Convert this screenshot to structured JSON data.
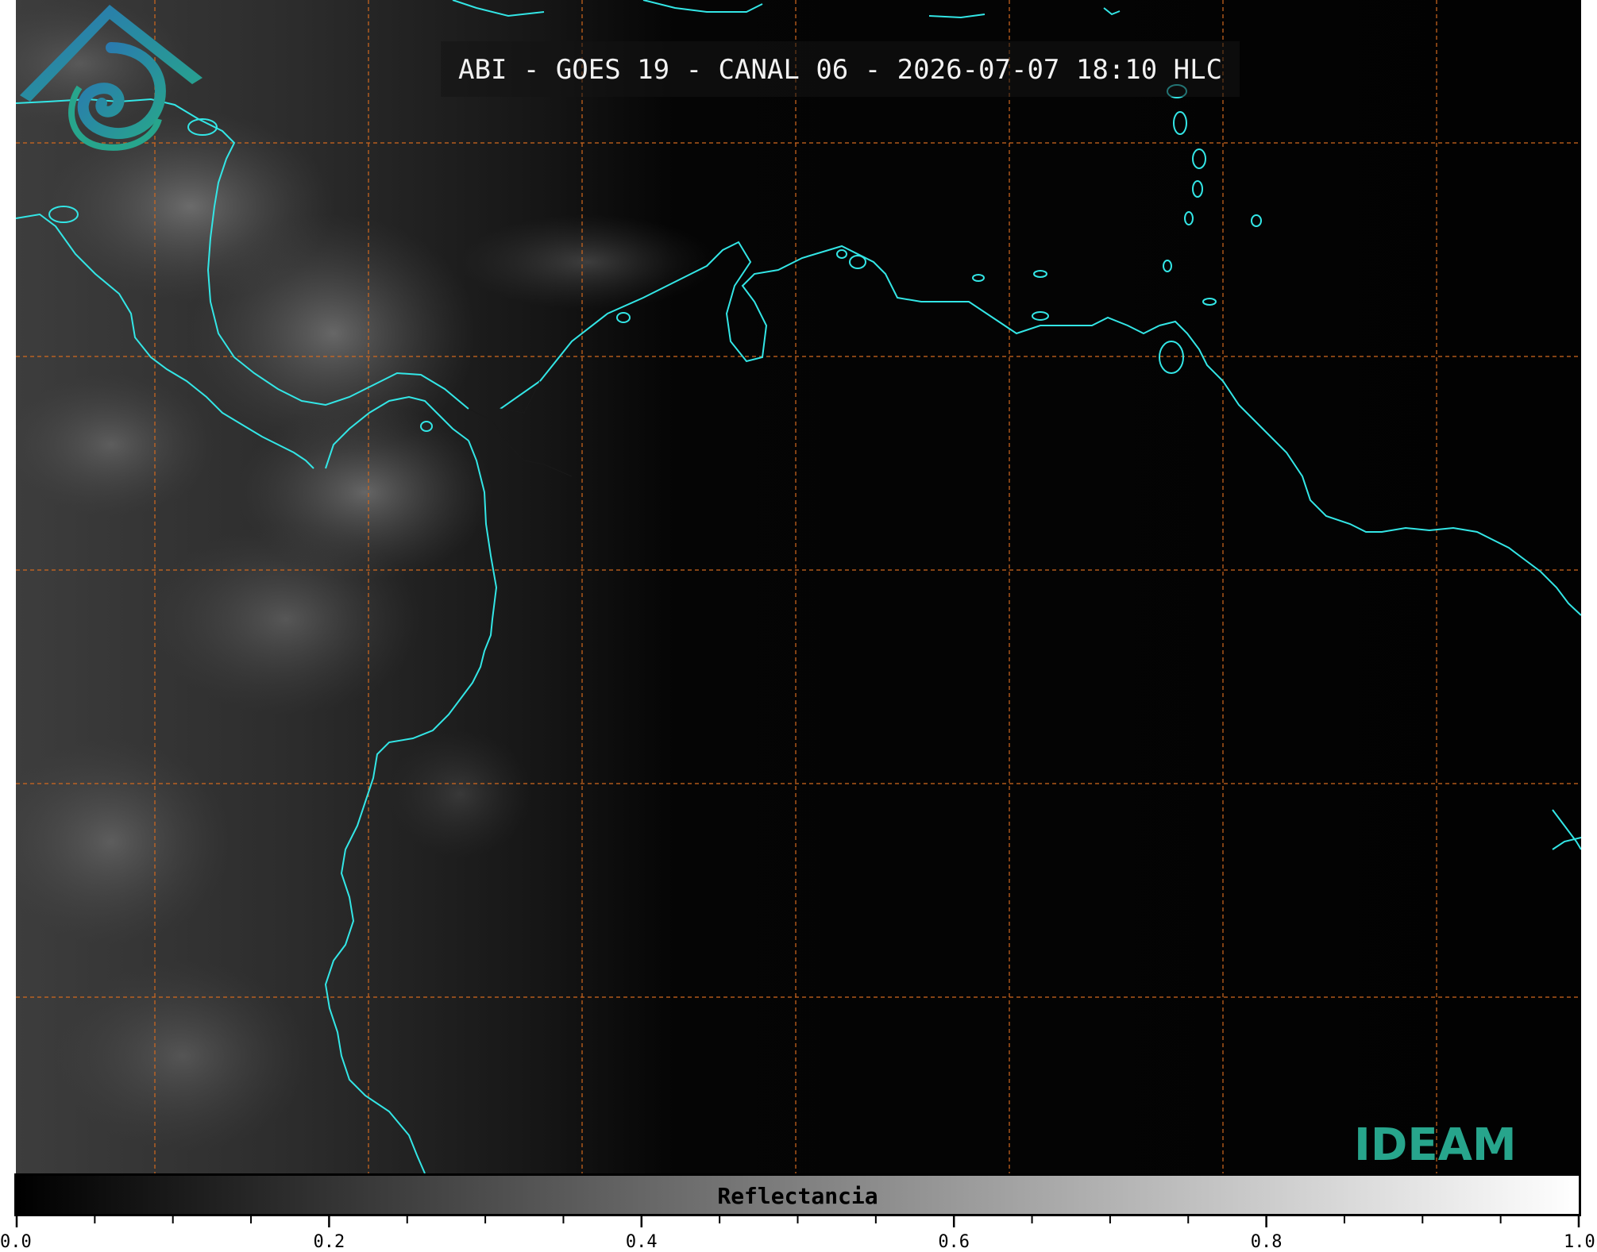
{
  "title": "ABI - GOES 19 - CANAL 06 - 2026-07-07 18:10 HLC",
  "logo": {
    "text": "IDEAM",
    "icon": "ideam-logo-icon",
    "colors": [
      "#2a73b5",
      "#27a58c"
    ]
  },
  "colorbar": {
    "label": "Reflectancia",
    "min": 0.0,
    "max": 1.0,
    "tick_labels": [
      "0.0",
      "0.2",
      "0.4",
      "0.6",
      "0.8",
      "1.0"
    ],
    "major_ticks": [
      0.0,
      0.2,
      0.4,
      0.6,
      0.8,
      1.0
    ],
    "minor_ticks": [
      0.05,
      0.1,
      0.15,
      0.25,
      0.3,
      0.35,
      0.45,
      0.5,
      0.55,
      0.65,
      0.7,
      0.75,
      0.85,
      0.9,
      0.95
    ],
    "colormap": [
      "#000000",
      "#ffffff"
    ]
  },
  "map": {
    "background": "#020202",
    "coastline_color": "#33e6e6",
    "grid_color": "#d2691e",
    "grid_style": "dashed"
  }
}
